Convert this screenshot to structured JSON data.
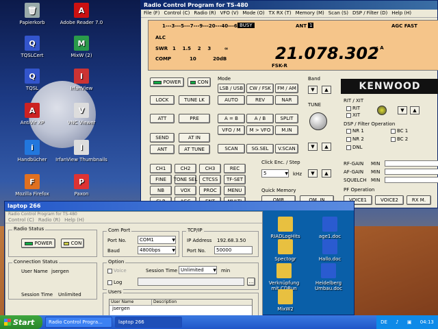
{
  "desktop": {
    "icons": [
      {
        "label": "Papierkorb",
        "glyph": "🗑",
        "color": "#9aa"
      },
      {
        "label": "TQSLCert",
        "glyph": "Q",
        "color": "#3355cc"
      },
      {
        "label": "TQSL",
        "glyph": "Q",
        "color": "#3355cc"
      },
      {
        "label": "AntiVir XP",
        "glyph": "A",
        "color": "#cc2222"
      },
      {
        "label": "Handbücher",
        "glyph": "i",
        "color": "#2277dd"
      },
      {
        "label": "Mozilla Firefox",
        "glyph": "F",
        "color": "#e07020"
      },
      {
        "label": "Adobe Reader 7.0",
        "glyph": "A",
        "color": "#cc1111"
      },
      {
        "label": "MixW (2)",
        "glyph": "M",
        "color": "#2a9a4a"
      },
      {
        "label": "IrfanView",
        "glyph": "I",
        "color": "#cc3333"
      },
      {
        "label": "VNC Viewer",
        "glyph": "V",
        "color": "#ddd"
      },
      {
        "label": "IrfanView Thumbnails",
        "glyph": "I",
        "color": "#ddd"
      },
      {
        "label": "Paxon",
        "glyph": "P",
        "color": "#dd3333"
      }
    ]
  },
  "radio": {
    "title": "Radio Control Program for TS-480",
    "menu": [
      "File (F)",
      "Control (C)",
      "Radio (R)",
      "VFO (V)",
      "Mode (O)",
      "TX RX (T)",
      "Memory (M)",
      "Scan (S)",
      "DSP / Filter (D)",
      "Help (H)"
    ],
    "display": {
      "meter_scale": "1---3---5---7---9---20---40---60dB",
      "busy": "BUSY",
      "ant": "ANT",
      "ant_num": "1",
      "agc": "AGC FAST",
      "alc": "ALC",
      "swr": "SWR",
      "swr_scale": "1    1.5    2    3        ∞",
      "comp": "COMP",
      "comp_scale": "10          20dB",
      "frequency": "21.078.302",
      "freq_suffix": "< A",
      "mode": "FSK-R"
    },
    "buttons": {
      "power": "POWER",
      "con": "CON",
      "lock": "LOCK",
      "tune_lk": "TUNE LK",
      "att": "ATT",
      "pre": "PRE",
      "send": "SEND",
      "at_in": "AT IN",
      "ant": "ANT",
      "at_tune": "AT TUNE",
      "lsb_usb": "LSB / USB",
      "cw_fsk": "CW / FSK",
      "fm_am": "FM / AM",
      "auto": "AUTO",
      "rev": "REV",
      "nar": "NAR",
      "a_b_eq": "A = B",
      "a_b": "A / B",
      "split": "SPLIT",
      "vfo_m": "VFO / M",
      "m_vfo": "M > VFO",
      "m_in": "M.IN",
      "scan": "SCAN",
      "sg_sel": "SG.SEL",
      "v_scan": "V.SCAN",
      "ch1": "CH1",
      "ch2": "CH2",
      "ch3": "CH3",
      "rec": "REC",
      "fine": "FINE",
      "tone_sel": "TONE SEL",
      "ctcss": "CTCSS",
      "tf_set": "TF-SET",
      "nb": "NB",
      "vox": "VOX",
      "proc": "PROC",
      "menu": "MENU",
      "clr": "CLR",
      "agc": "AGC",
      "ent": "ENT",
      "multi": "MULTI",
      "qmr": "QMR",
      "qm_in": "QM. IN",
      "voice1": "VOICE1",
      "voice2": "VOICE2",
      "rx_m": "RX M."
    },
    "labels": {
      "mode": "Mode",
      "band": "Band",
      "tune": "TUNE",
      "click_enc": "Click Enc. / Step",
      "step_val": "5",
      "khz": "kHz",
      "quick_memory": "Quick Memory",
      "rit_xit": "RIT / XIT",
      "rit": "RIT",
      "xit": "XIT",
      "dsp": "DSP / Filter Operation",
      "nr1": "NR 1",
      "nr2": "NR 2",
      "dnl": "DNL",
      "bc1": "BC 1",
      "bc2": "BC 2",
      "rf_gain": "RF-GAIN",
      "af_gain": "AF-GAIN",
      "squelch": "SQUELCH",
      "min": "MIN",
      "pf_operation": "PF Operation",
      "brand": "KENWOOD"
    }
  },
  "laptop": {
    "title": "laptop 266",
    "subtitle": "Radio Control Program for TS-480",
    "menu": [
      "Control (C)",
      "Radio (R)",
      "Help (H)"
    ],
    "radio_status": "Radio Status",
    "power": "POWER",
    "con": "CON",
    "conn_status": "Connection Status",
    "user_name_label": "User Name",
    "user_name": "jsergen",
    "session_time_label": "Session Time",
    "session_time": "Unlimited",
    "com_port": "Com Port",
    "port_no_label": "Port No.",
    "port_no": "COM1",
    "baud_label": "Baud",
    "baud": "4800bps",
    "tcpip": "TCP/IP",
    "ip_label": "IP Address",
    "ip": "192.68.3.50",
    "tcp_port_label": "Port No.",
    "tcp_port": "50000",
    "option": "Option",
    "voice": "Voice",
    "log": "Log",
    "session_time2": "Session Time",
    "session_val": "Unlimited",
    "min": "min",
    "users": "Users",
    "col_user": "User Name",
    "col_desc": "Description",
    "user_row": "jsergen",
    "icons": [
      {
        "label": "RIADLogHits"
      },
      {
        "label": "age1.doc"
      },
      {
        "label": "Spectogr"
      },
      {
        "label": "Hallo.doc"
      },
      {
        "label": "Verknüpfung mit CDRun"
      },
      {
        "label": "Heidelberg Umbau.doc"
      },
      {
        "label": "MixW2"
      }
    ]
  },
  "taskbar": {
    "start": "Start",
    "tasks": [
      "Radio Control Progra...",
      "laptop 266"
    ],
    "lang": "DE",
    "clock": "04:13"
  }
}
